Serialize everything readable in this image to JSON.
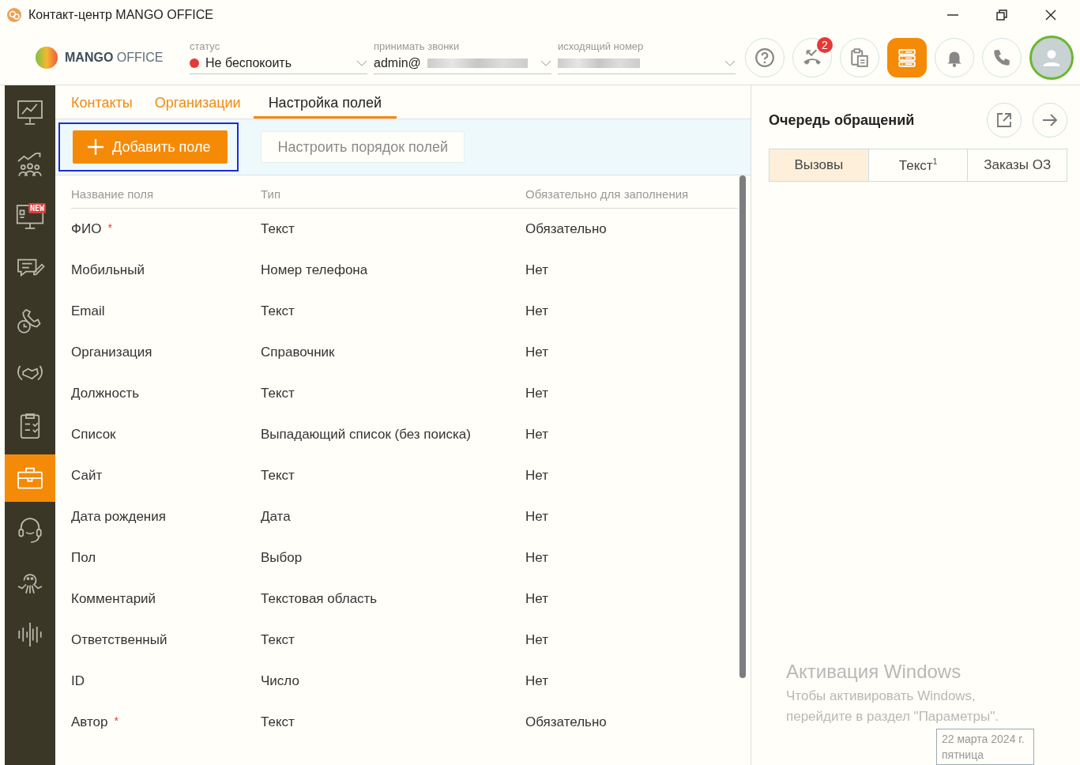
{
  "window": {
    "title": "Контакт-центр MANGO OFFICE"
  },
  "header": {
    "logo": {
      "brand": "MANGO",
      "product": "OFFICE"
    },
    "status": {
      "label": "статус",
      "value": "Не беспокоить",
      "color": "#e53935"
    },
    "receive_calls": {
      "label": "принимать звонки",
      "value": "admin@"
    },
    "outgoing_number": {
      "label": "исходящий номер"
    },
    "toolbar": [
      {
        "kind": "help",
        "selected": false
      },
      {
        "kind": "missed",
        "badge": "2",
        "selected": false
      },
      {
        "kind": "clipboard",
        "selected": false
      },
      {
        "kind": "queue",
        "selected": true
      },
      {
        "kind": "bell",
        "selected": false
      },
      {
        "kind": "phone",
        "selected": false
      }
    ]
  },
  "sidebar": {
    "items": [
      {
        "kind": "monitor-chart",
        "selected": false
      },
      {
        "kind": "team-growth",
        "selected": false
      },
      {
        "kind": "monitor-new",
        "badge": "NEW",
        "selected": false
      },
      {
        "kind": "chat-edit",
        "selected": false
      },
      {
        "kind": "phone-clock",
        "selected": false
      },
      {
        "kind": "handshake",
        "selected": false
      },
      {
        "kind": "checklist",
        "selected": false
      },
      {
        "kind": "briefcase",
        "selected": true
      },
      {
        "kind": "headset",
        "selected": false
      },
      {
        "kind": "octopus",
        "selected": false
      },
      {
        "kind": "soundwave",
        "selected": false
      }
    ]
  },
  "tabs": [
    {
      "label": "Контакты",
      "selected": false
    },
    {
      "label": "Организации",
      "selected": false
    },
    {
      "label": "Настройка полей",
      "selected": true
    }
  ],
  "actions": {
    "add_button": {
      "label": "Добавить поле",
      "focused": true
    },
    "order_button": {
      "label": "Настроить порядок полей"
    }
  },
  "table": {
    "columns": [
      "Название поля",
      "Тип",
      "Обязательно для заполнения"
    ],
    "rows": [
      {
        "name": "ФИО",
        "required_mark": "*",
        "type": "Текст",
        "mandatory": "Обязательно"
      },
      {
        "name": "Мобильный",
        "type": "Номер телефона",
        "mandatory": "Нет"
      },
      {
        "name": "Email",
        "type": "Текст",
        "mandatory": "Нет"
      },
      {
        "name": "Организация",
        "type": "Справочник",
        "mandatory": "Нет"
      },
      {
        "name": "Должность",
        "type": "Текст",
        "mandatory": "Нет"
      },
      {
        "name": "Список",
        "type": "Выпадающий список (без поиска)",
        "mandatory": "Нет"
      },
      {
        "name": "Сайт",
        "type": "Текст",
        "mandatory": "Нет"
      },
      {
        "name": "Дата рождения",
        "type": "Дата",
        "mandatory": "Нет"
      },
      {
        "name": "Пол",
        "type": "Выбор",
        "mandatory": "Нет"
      },
      {
        "name": "Комментарий",
        "type": "Текстовая область",
        "mandatory": "Нет"
      },
      {
        "name": "Ответственный",
        "type": "Текст",
        "mandatory": "Нет"
      },
      {
        "name": "ID",
        "type": "Число",
        "mandatory": "Нет"
      },
      {
        "name": "Автор",
        "required_mark": "*",
        "type": "Текст",
        "mandatory": "Обязательно"
      }
    ]
  },
  "queue": {
    "title": "Очередь обращений",
    "tabs": [
      {
        "label": "Вызовы",
        "selected": true
      },
      {
        "label": "Текст",
        "count": "1",
        "selected": false
      },
      {
        "label": "Заказы ОЗ",
        "selected": false
      }
    ]
  },
  "os_notice": {
    "title": "Активация Windows",
    "text": "Чтобы активировать Windows, перейдите в раздел \"Параметры\".",
    "date": "22 марта 2024 г.",
    "weekday": "пятница"
  }
}
